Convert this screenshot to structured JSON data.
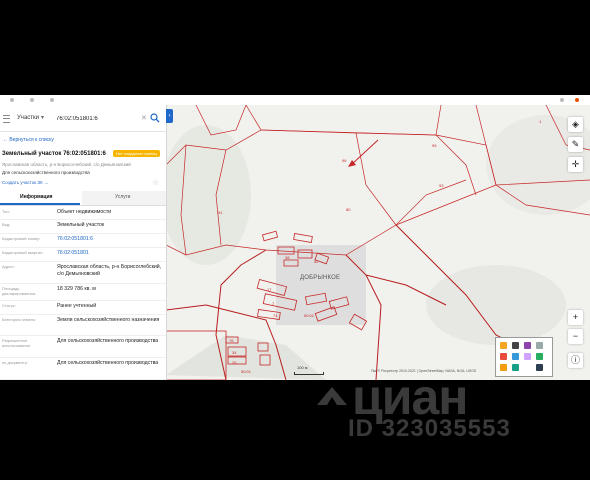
{
  "search": {
    "type_label": "Участки",
    "value": "76:02:051801:6"
  },
  "panel": {
    "back_link": "← Вернуться к списку",
    "title": "Земельный участок 76:02:051801:6",
    "badge": "Нет координат границ",
    "address_line": "Ярославская область, р-н Борисоглебский, с/о Демьяновский",
    "purpose_line": "Для сельскохозяйственного производства",
    "parcels_link": "Создать участок ЗК →",
    "tabs": [
      "Информация",
      "Услуги"
    ],
    "rows": [
      {
        "label": "Тип:",
        "value": "Объект недвижимости"
      },
      {
        "label": "Вид:",
        "value": "Земельный участок"
      },
      {
        "label": "Кадастровый номер:",
        "value": "76:02:051801:6"
      },
      {
        "label": "Кадастровый квартал:",
        "value": "76:02:051801"
      },
      {
        "label": "Адрес:",
        "value": "Ярославская область, р-н Борисоглебский, с/о Демьяновский"
      },
      {
        "label": "Площадь декларированная:",
        "value": "18 329 786 кв. м"
      },
      {
        "label": "Статус:",
        "value": "Ранее учтенный"
      },
      {
        "label": "Категория земель:",
        "value": "Земли сельскохозяйственного назначения"
      },
      {
        "label": "Разрешенное использование:",
        "value": "Для сельскохозяйственного производства"
      },
      {
        "label": "по документу:",
        "value": "Для сельскохозяйственного производства"
      }
    ]
  },
  "map": {
    "village_label": "ДОБРЫНКОЕ",
    "scale_label": "100 м",
    "copyright": "Пкк © Росреестр 2010-2021 | OpenStreetMap, NASA, NGA, USGS",
    "parcel_labels": [
      "96",
      "91",
      "80",
      "93",
      "1",
      "95",
      "38",
      "52",
      "17",
      "7",
      "74",
      "50:01",
      "50:01",
      "76",
      "34",
      "25"
    ]
  },
  "watermark": {
    "brand": "циан",
    "id": "ID 323035553"
  }
}
